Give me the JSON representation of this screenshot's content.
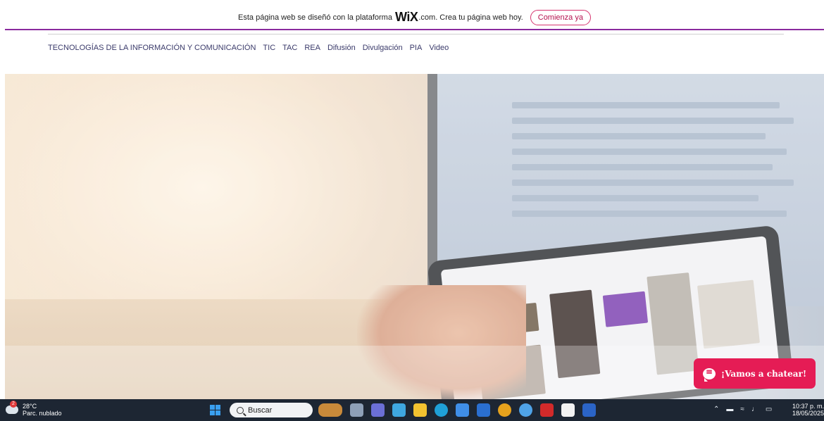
{
  "banner": {
    "text_before": "Esta página web se diseñó con la plataforma",
    "brand": "WiX",
    "text_after": ".com. Crea tu página web hoy.",
    "cta": "Comienza ya"
  },
  "nav": {
    "items": [
      "TECNOLOGÍAS DE LA INFORMACIÓN Y COMUNICACIÓN",
      "TIC",
      "TAC",
      "REA",
      "Difusión",
      "Divulgación",
      "PIA",
      "Video"
    ]
  },
  "chat": {
    "label": "¡Vamos a chatear!",
    "icon": "chat-bubble-icon",
    "color": "#e51c55"
  },
  "taskbar": {
    "weather": {
      "temp": "28°C",
      "condition": "Parc. nublado",
      "badge": "2"
    },
    "search_label": "Buscar",
    "clock": {
      "time": "10:37 p. m.",
      "date": "18/05/2025"
    },
    "tray_icons": [
      "chevron-up-icon",
      "network-icon",
      "wifi-icon",
      "volume-icon",
      "battery-icon"
    ],
    "apps": [
      {
        "name": "widget-app-icon",
        "color": "#c98a3a"
      },
      {
        "name": "task-view-icon",
        "color": "#8ea0b8"
      },
      {
        "name": "teams-icon",
        "color": "#6b6fd6"
      },
      {
        "name": "copilot-icon",
        "color": "#3fa7e0"
      },
      {
        "name": "file-explorer-icon",
        "color": "#f2c230"
      },
      {
        "name": "edge-icon",
        "color": "#1fa0d8"
      },
      {
        "name": "store-icon",
        "color": "#3f8ee8"
      },
      {
        "name": "mail-icon",
        "color": "#2a6fd1"
      },
      {
        "name": "chrome-icon",
        "color": "#e6a21d"
      },
      {
        "name": "chrome-canary-icon",
        "color": "#4fa3e8"
      },
      {
        "name": "mcafee-icon",
        "color": "#d22a2a"
      },
      {
        "name": "capcut-icon",
        "color": "#f2f2f2"
      },
      {
        "name": "word-icon",
        "color": "#2b64c6"
      }
    ]
  }
}
